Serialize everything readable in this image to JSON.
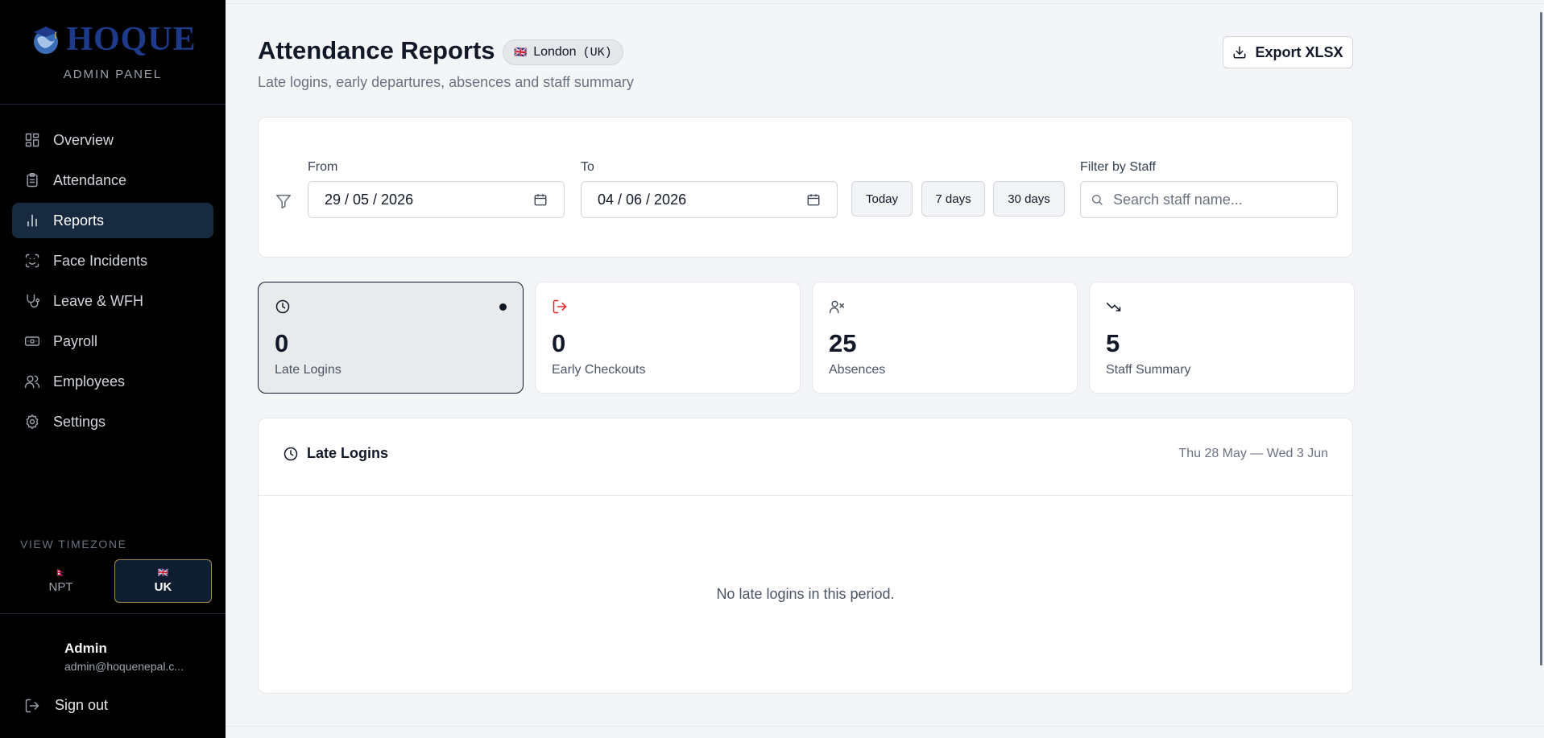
{
  "brand": {
    "name": "HOQUE",
    "subtitle": "ADMIN PANEL"
  },
  "nav": {
    "items": [
      {
        "label": "Overview",
        "icon": "grid-icon"
      },
      {
        "label": "Attendance",
        "icon": "clipboard-icon"
      },
      {
        "label": "Reports",
        "icon": "bar-chart-icon",
        "active": true
      },
      {
        "label": "Face Incidents",
        "icon": "face-scan-icon"
      },
      {
        "label": "Leave & WFH",
        "icon": "stethoscope-icon"
      },
      {
        "label": "Payroll",
        "icon": "banknote-icon"
      },
      {
        "label": "Employees",
        "icon": "users-icon"
      },
      {
        "label": "Settings",
        "icon": "gear-icon"
      }
    ]
  },
  "timezone": {
    "title": "VIEW TIMEZONE",
    "options": [
      {
        "label": "NPT",
        "flag": "🇳🇵",
        "selected": false
      },
      {
        "label": "UK",
        "flag": "🇬🇧",
        "selected": true
      }
    ]
  },
  "user": {
    "name": "Admin",
    "email": "admin@hoquenepal.c...",
    "signout_label": "Sign out"
  },
  "header": {
    "title": "Attendance Reports",
    "region_flag": "🇬🇧",
    "region_name": "London",
    "region_code": "(UK)",
    "subtitle": "Late logins, early departures, absences and staff summary",
    "export_label": "Export XLSX"
  },
  "filters": {
    "from_label": "From",
    "from_value": "29 / 05 / 2026",
    "to_label": "To",
    "to_value": "04 / 06 / 2026",
    "presets": [
      "Today",
      "7 days",
      "30 days"
    ],
    "staff_label": "Filter by Staff",
    "staff_placeholder": "Search staff name..."
  },
  "stats": [
    {
      "value": "0",
      "label": "Late Logins",
      "icon": "clock-icon",
      "color": "#111827",
      "selected": true
    },
    {
      "value": "0",
      "label": "Early Checkouts",
      "icon": "log-out-icon",
      "color": "#dc2626",
      "selected": false
    },
    {
      "value": "25",
      "label": "Absences",
      "icon": "user-x-icon",
      "color": "#4b5563",
      "selected": false
    },
    {
      "value": "5",
      "label": "Staff Summary",
      "icon": "trending-down-icon",
      "color": "#111827",
      "selected": false
    }
  ],
  "table": {
    "title": "Late Logins",
    "range": "Thu 28 May — Wed 3 Jun",
    "empty_message": "No late logins in this period."
  },
  "colors": {
    "sidebar_bg": "#000000",
    "active_nav": "#172a3f",
    "brand": "#1e3a8a",
    "accent_border": "#a3884d"
  }
}
